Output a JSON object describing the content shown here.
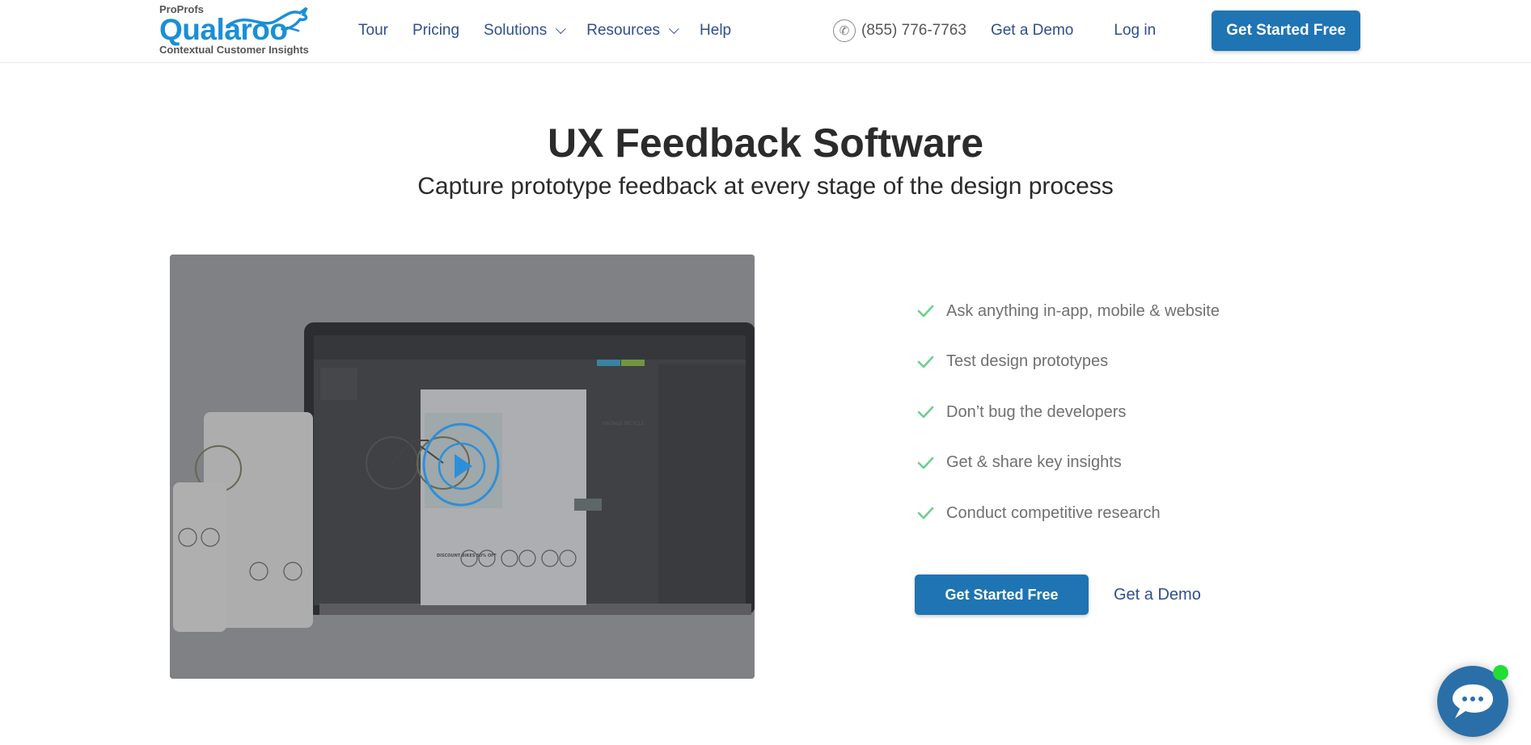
{
  "header": {
    "logo": {
      "parent_brand": "ProProfs",
      "brand": "Qualaroo",
      "tagline": "Contextual Customer Insights"
    },
    "nav": [
      {
        "label": "Tour",
        "has_dropdown": false
      },
      {
        "label": "Pricing",
        "has_dropdown": false
      },
      {
        "label": "Solutions",
        "has_dropdown": true
      },
      {
        "label": "Resources",
        "has_dropdown": true
      },
      {
        "label": "Help",
        "has_dropdown": false
      }
    ],
    "phone": "(855) 776-7763",
    "demo_label": "Get a Demo",
    "login_label": "Log in",
    "cta_label": "Get Started Free"
  },
  "hero": {
    "title": "UX Feedback Software",
    "subtitle": "Capture prototype feedback at every stage of the design process",
    "media": {
      "description": "Prototype design tool mockup on laptop, tablet and phone showing a vintage bicycle product page",
      "play_icon": "play-icon",
      "mockup_texts": [
        "VINTAGE BICYCLE",
        "DISCOUNT BIKES 50% OFF"
      ]
    },
    "features": [
      "Ask anything in-app, mobile & website",
      "Test design prototypes",
      "Don’t bug the developers",
      "Get & share key insights",
      "Conduct competitive research"
    ],
    "cta_label": "Get Started Free",
    "demo_label": "Get a Demo"
  },
  "chat_widget": {
    "icon": "chat-bubble-icon",
    "status": "online"
  },
  "colors": {
    "brand_blue": "#1a8fd6",
    "button_blue": "#1f74b3",
    "nav_text": "#2f4f8f",
    "check_green": "#6dcf8d",
    "online_green": "#22dd33"
  }
}
